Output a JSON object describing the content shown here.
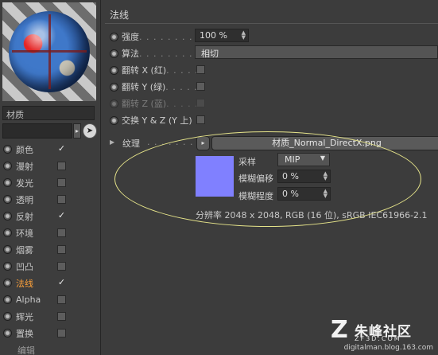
{
  "colors": {
    "accent": "#ffa23a",
    "texture_swatch": "#8080ff",
    "annotation": "#e6e48a"
  },
  "material": {
    "label": "材质",
    "name_value": "",
    "channels": [
      {
        "label": "颜色",
        "checked": true,
        "active": false
      },
      {
        "label": "漫射",
        "checked": false,
        "active": false
      },
      {
        "label": "发光",
        "checked": false,
        "active": false
      },
      {
        "label": "透明",
        "checked": false,
        "active": false
      },
      {
        "label": "反射",
        "checked": true,
        "active": false
      },
      {
        "label": "环境",
        "checked": false,
        "active": false
      },
      {
        "label": "烟雾",
        "checked": false,
        "active": false
      },
      {
        "label": "凹凸",
        "checked": false,
        "active": false
      },
      {
        "label": "法线",
        "checked": true,
        "active": true
      },
      {
        "label": "Alpha",
        "checked": false,
        "active": false
      },
      {
        "label": "辉光",
        "checked": false,
        "active": false
      },
      {
        "label": "置换",
        "checked": false,
        "active": false
      }
    ],
    "edit_label": "编辑"
  },
  "normal": {
    "section_title": "法线",
    "strength": {
      "label": "强度",
      "dots": " . . . . . . . . . .",
      "value": "100 %"
    },
    "algorithm": {
      "label": "算法",
      "dots": " . . . . . . . . . .",
      "value": "相切"
    },
    "flip_x": {
      "label": "翻转 X (红)",
      "dots": " . . . . ."
    },
    "flip_y": {
      "label": "翻转 Y (绿)",
      "dots": " . . . . ."
    },
    "flip_z": {
      "label": "翻转 Z (蓝)",
      "dots": " . . . . ."
    },
    "swap": {
      "label": "交换 Y & Z (Y 上)"
    },
    "texture": {
      "label": "纹理",
      "dots": ". . . . . . . . .",
      "file": "材质_Normal_DirectX.png",
      "sampling_label": "采样",
      "sampling_value": "MIP",
      "blur_offset_label": "模糊偏移",
      "blur_offset_value": "0 %",
      "blur_degree_label": "模糊程度",
      "blur_degree_value": "0 %",
      "resolution": "分辨率 2048 x 2048, RGB (16 位), sRGB IEC61966-2.1"
    }
  },
  "watermark": {
    "name": "朱峰社区",
    "site": "ZF3D.COM",
    "blog": "digitalman.blog.163.com"
  }
}
